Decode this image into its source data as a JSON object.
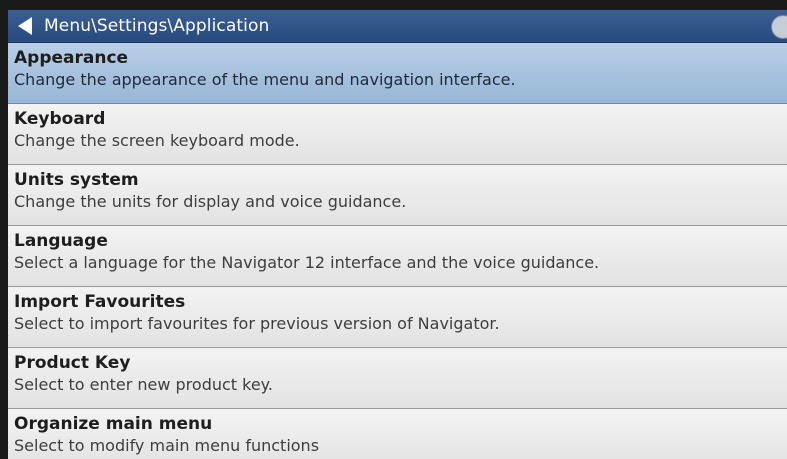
{
  "header": {
    "breadcrumb": "Menu\\Settings\\Application",
    "back_icon": "triangle-left-icon"
  },
  "items": [
    {
      "title": "Appearance",
      "description": "Change the appearance of the menu and navigation interface.",
      "selected": true
    },
    {
      "title": "Keyboard",
      "description": "Change the screen keyboard mode."
    },
    {
      "title": "Units system",
      "description": "Change the units for display and voice guidance."
    },
    {
      "title": "Language",
      "description": "Select a language for the Navigator 12 interface and the voice guidance."
    },
    {
      "title": "Import Favourites",
      "description": "Select to import favourites for previous version of Navigator."
    },
    {
      "title": "Product Key",
      "description": "Select to enter new product key."
    },
    {
      "title": "Organize main menu",
      "description": "Select to modify main menu functions"
    }
  ],
  "colors": {
    "titlebar": "#2f5287",
    "selected_item": "#a8c2de",
    "item_background": "#ebebeb"
  }
}
